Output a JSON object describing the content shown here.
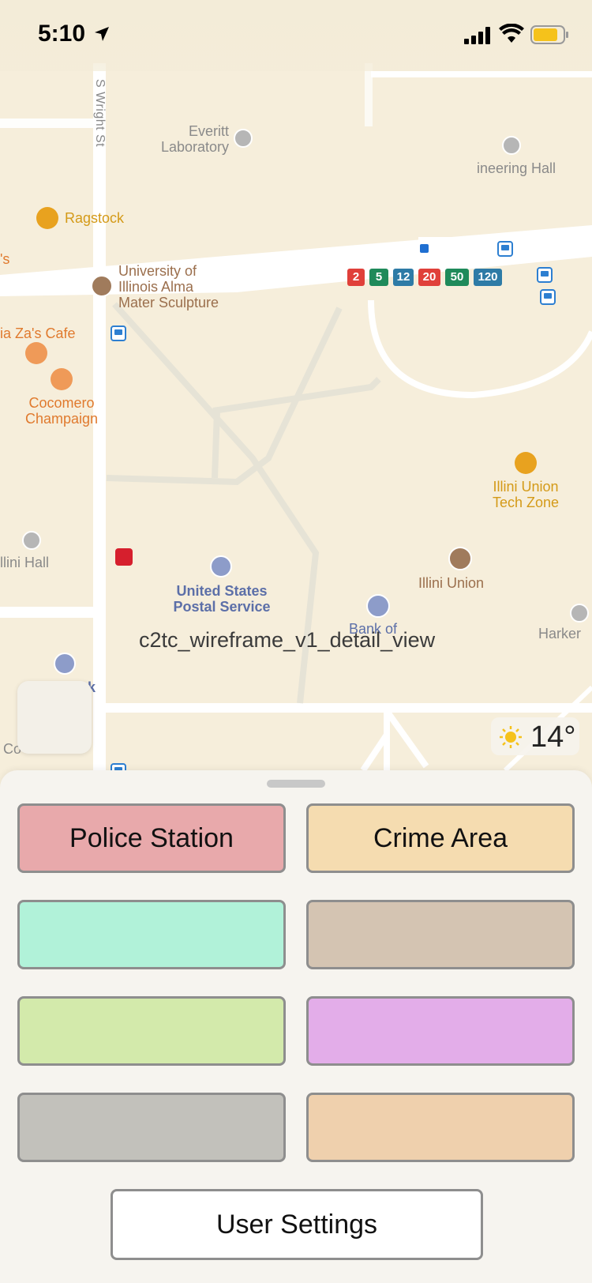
{
  "status_bar": {
    "time": "5:10"
  },
  "map": {
    "streets": {
      "s_wright": "S Wright St"
    },
    "places": {
      "everitt": "Everitt\nLaboratory",
      "engineering": "ineering Hall",
      "ragstock": "Ragstock",
      "edge_s": "'s",
      "alma_mater": "University of\nIllinois Alma\nMater Sculpture",
      "pizza": "ia Za's Cafe",
      "cocomero": "Cocomero\nChampaign",
      "tech_zone": "Illini Union\nTech Zone",
      "illini_hall": "llini Hall",
      "usps": "United States\nPostal Service",
      "illini_union": "Illini Union",
      "bank_of": "Bank of",
      "harker": "Harker",
      "bank_left": "nk",
      "co": "Co"
    },
    "routes": [
      {
        "label": "2",
        "color": "#e0403a"
      },
      {
        "label": "5",
        "color": "#1f8a5a"
      },
      {
        "label": "12",
        "color": "#2e7ba6"
      },
      {
        "label": "20",
        "color": "#e0403a"
      },
      {
        "label": "50",
        "color": "#1f8a5a"
      },
      {
        "label": "120",
        "color": "#2e7ba6"
      }
    ],
    "overlay_title": "c2tc_wireframe_v1_detail_view",
    "weather": {
      "temp": "14°",
      "icon": "sun-icon"
    }
  },
  "panel": {
    "buttons": [
      {
        "label": "Police Station",
        "color": "#e8a9ab"
      },
      {
        "label": "Crime Area",
        "color": "#f5dcb0"
      },
      {
        "label": "",
        "color": "#b1f2d9"
      },
      {
        "label": "",
        "color": "#d4c4b2"
      },
      {
        "label": "",
        "color": "#d3eaab"
      },
      {
        "label": "",
        "color": "#e3ade9"
      },
      {
        "label": "",
        "color": "#c2c1bb"
      },
      {
        "label": "",
        "color": "#efd0ad"
      }
    ],
    "settings_label": "User Settings"
  }
}
